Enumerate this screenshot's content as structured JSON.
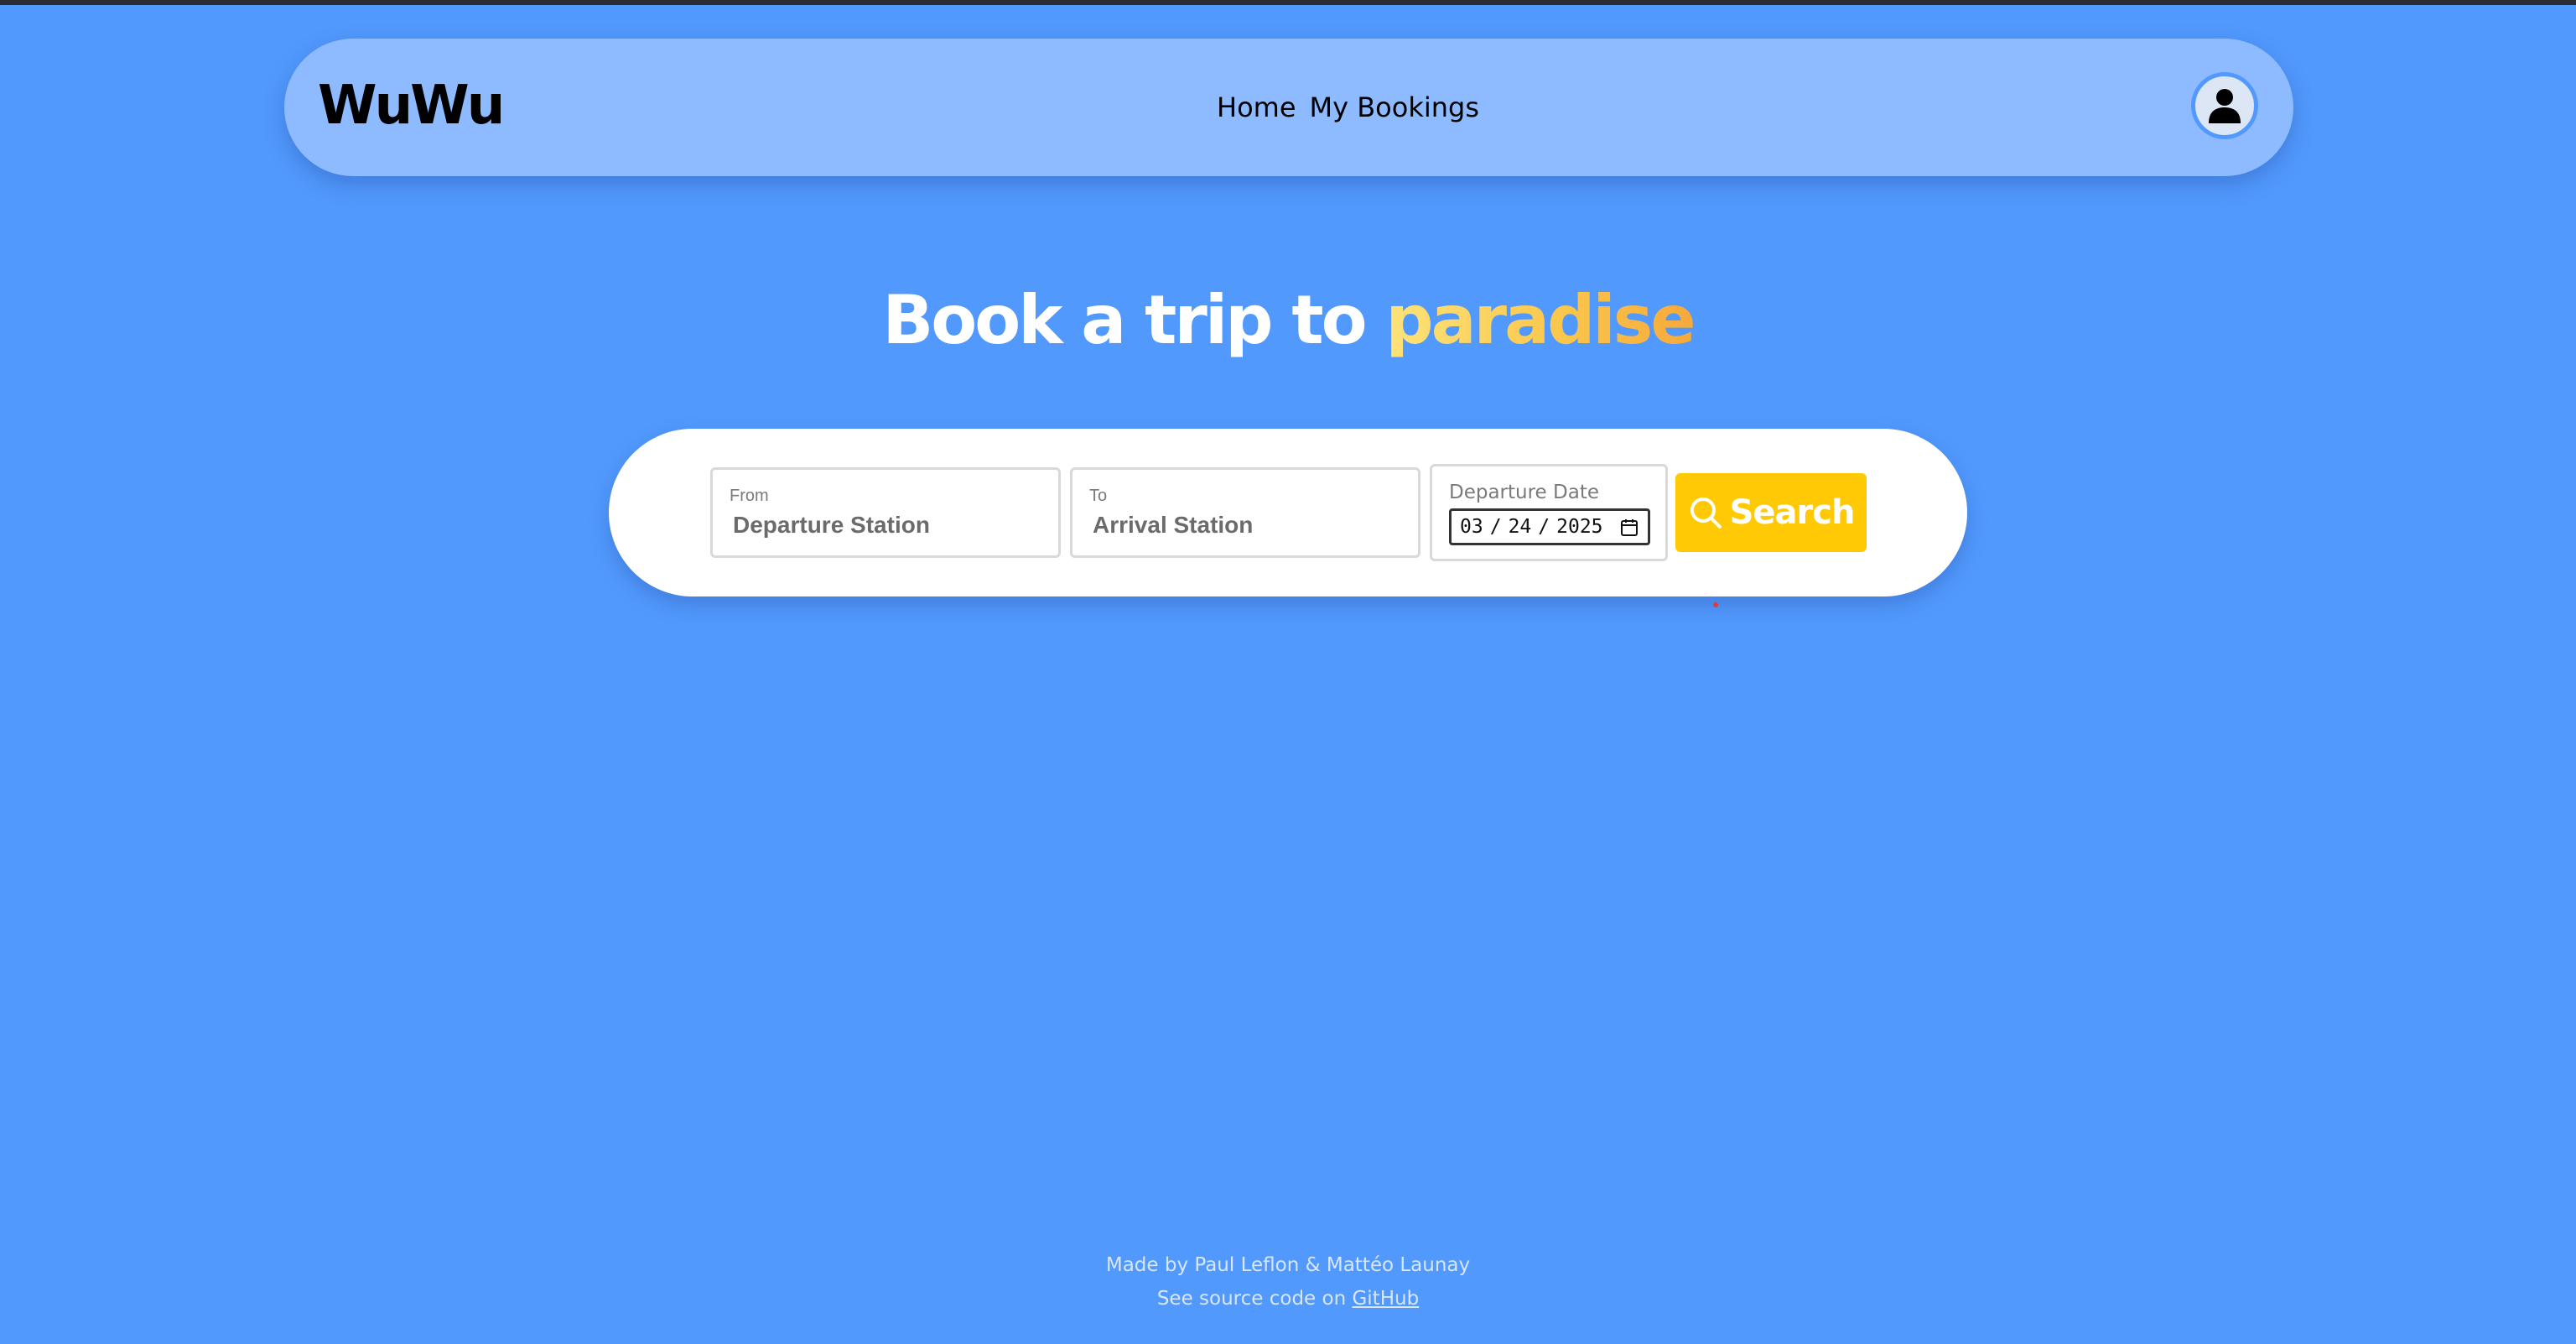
{
  "navbar": {
    "logo": "WuWu",
    "links": [
      {
        "label": "Home"
      },
      {
        "label": "My Bookings"
      }
    ],
    "profile_icon": "user-icon"
  },
  "hero": {
    "title_prefix": "Book a trip to ",
    "title_accent": "paradise"
  },
  "search": {
    "from": {
      "label": "From",
      "placeholder": "Departure Station"
    },
    "to": {
      "label": "To",
      "placeholder": "Arrival Station"
    },
    "date": {
      "label": "Departure Date",
      "month": "03",
      "day": "24",
      "year": "2025",
      "icon": "calendar-icon"
    },
    "button_label": "Search",
    "button_icon": "search-icon"
  },
  "footer": {
    "credits": "Made by Paul Leflon & Mattéo Launay",
    "source_prefix": "See source code on ",
    "source_link": "GitHub"
  },
  "colors": {
    "background": "#5299fd",
    "navbar": "#8ebbff",
    "accent_button": "#ffc906"
  }
}
